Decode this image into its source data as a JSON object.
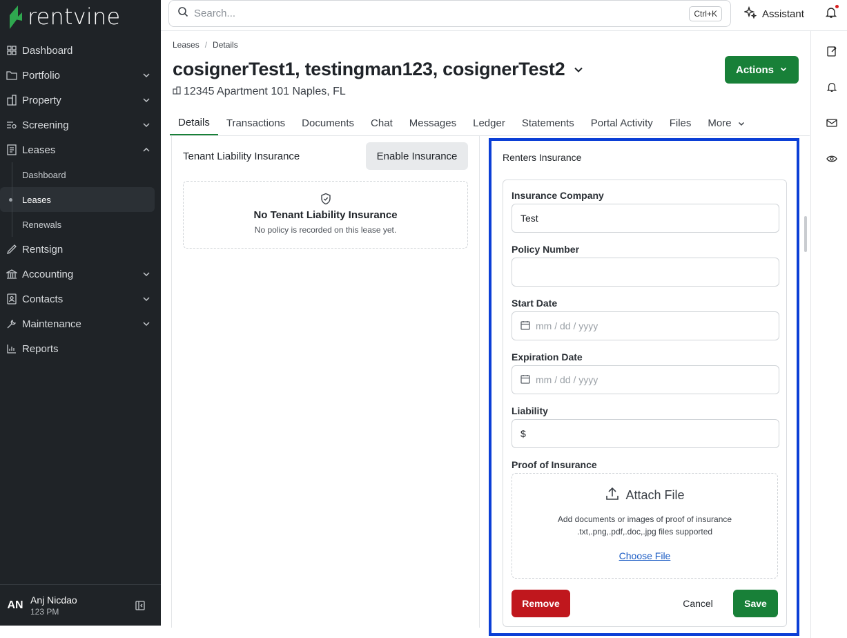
{
  "brand": {
    "name": "rentvine",
    "accent": "#188038"
  },
  "search": {
    "placeholder": "Search...",
    "shortcut": "Ctrl+K"
  },
  "topbar": {
    "assistant_label": "Assistant"
  },
  "sidebar": {
    "items": [
      {
        "label": "Dashboard",
        "icon": "dashboard-icon"
      },
      {
        "label": "Portfolio",
        "icon": "portfolio-icon"
      },
      {
        "label": "Property",
        "icon": "property-icon"
      },
      {
        "label": "Screening",
        "icon": "screening-icon"
      },
      {
        "label": "Leases",
        "icon": "leases-icon"
      },
      {
        "label": "Rentsign",
        "icon": "rentsign-icon"
      },
      {
        "label": "Accounting",
        "icon": "accounting-icon"
      },
      {
        "label": "Contacts",
        "icon": "contacts-icon"
      },
      {
        "label": "Maintenance",
        "icon": "maintenance-icon"
      },
      {
        "label": "Reports",
        "icon": "reports-icon"
      }
    ],
    "leases_sub": [
      "Dashboard",
      "Leases",
      "Renewals"
    ]
  },
  "user": {
    "initials": "AN",
    "name": "Anj Nicdao",
    "time": "123 PM"
  },
  "breadcrumb": {
    "first": "Leases",
    "second": "Details"
  },
  "page": {
    "title": "cosignerTest1, testingman123, cosignerTest2",
    "address": "12345 Apartment 101 Naples, FL",
    "actions_label": "Actions"
  },
  "tabs": [
    "Details",
    "Transactions",
    "Documents",
    "Chat",
    "Messages",
    "Ledger",
    "Statements",
    "Portal Activity",
    "Files",
    "More"
  ],
  "tenant_liability": {
    "title": "Tenant Liability Insurance",
    "enable_label": "Enable Insurance",
    "empty_title": "No Tenant Liability Insurance",
    "empty_sub": "No policy is recorded on this lease yet."
  },
  "renters_insurance": {
    "title": "Renters Insurance",
    "company_label": "Insurance Company",
    "company_value": "Test",
    "policy_label": "Policy Number",
    "policy_value": "",
    "start_label": "Start Date",
    "start_placeholder": "mm / dd / yyyy",
    "expiration_label": "Expiration Date",
    "expiration_placeholder": "mm / dd / yyyy",
    "liability_label": "Liability",
    "liability_prefix": "$",
    "proof_label": "Proof of Insurance",
    "attach_label": "Attach File",
    "attach_sub": "Add documents or images of proof of insurance",
    "attach_types": ".txt,.png,.pdf,.doc,.jpg files supported",
    "choose_label": "Choose File",
    "remove_label": "Remove",
    "cancel_label": "Cancel",
    "save_label": "Save"
  }
}
